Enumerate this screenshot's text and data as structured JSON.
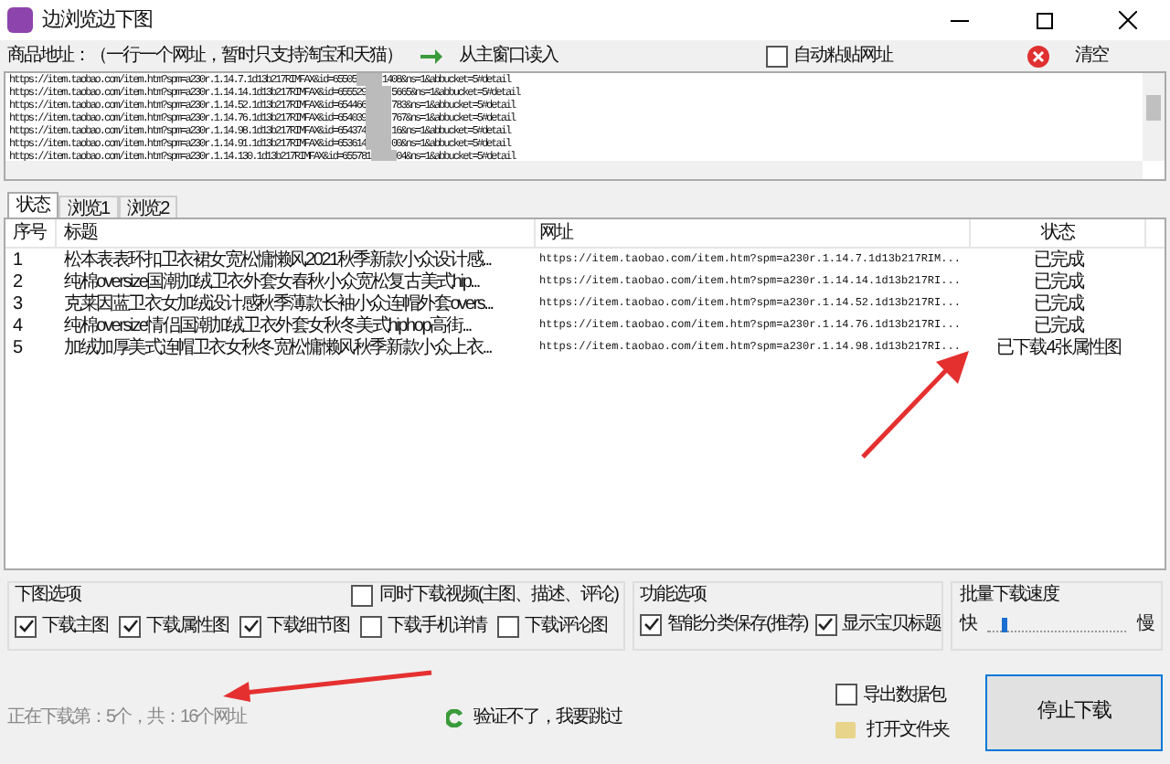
{
  "window": {
    "title": "边浏览边下图"
  },
  "address": {
    "label": "商品地址：（一行一个网址，暂时只支持淘宝和天猫）",
    "read_button": "从主窗口读入",
    "auto_paste": {
      "label": "自动粘贴网址",
      "checked": false
    },
    "clear_button": "清空"
  },
  "urls": [
    {
      "start": "https://item.taobao.com/item.htm?spm=a230r.1.14.7.1d13b217RIMFAX&id=65505",
      "end": "1408&ns=1&abbucket=5#detail"
    },
    {
      "start": "https://item.taobao.com/item.htm?spm=a230r.1.14.14.1d13b217RIMFAX&id=655529",
      "end": "5665&ns=1&abbucket=5#detail"
    },
    {
      "start": "https://item.taobao.com/item.htm?spm=a230r.1.14.52.1d13b217RIMFAX&id=654466",
      "end": "783&ns=1&abbucket=5#detail"
    },
    {
      "start": "https://item.taobao.com/item.htm?spm=a230r.1.14.76.1d13b217RIMFAX&id=654039",
      "end": "767&ns=1&abbucket=5#detail"
    },
    {
      "start": "https://item.taobao.com/item.htm?spm=a230r.1.14.98.1d13b217RIMFAX&id=654374",
      "end": "16&ns=1&abbucket=5#detail"
    },
    {
      "start": "https://item.taobao.com/item.htm?spm=a230r.1.14.91.1d13b217RIMFAX&id=653614",
      "end": "00&ns=1&abbucket=5#detail"
    },
    {
      "start": "https://item.taobao.com/item.htm?spm=a230r.1.14.130.1d13b217RIMFAX&id=655781",
      "end": "04&ns=1&abbucket=5#detail"
    }
  ],
  "tabs": [
    {
      "label": "状态",
      "selected": true
    },
    {
      "label": "浏览1",
      "selected": false
    },
    {
      "label": "浏览2",
      "selected": false
    }
  ],
  "table": {
    "columns": [
      "序号",
      "标题",
      "网址",
      "状态"
    ],
    "rows": [
      [
        "1",
        "松本表表环扣卫衣裙女宽松慵懒风2021秋季新款小众设计感...",
        "https://item.taobao.com/item.htm?spm=a230r.1.14.7.1d13b217RIM...",
        "已完成"
      ],
      [
        "2",
        "纯棉oversize国潮加绒卫衣外套女春秋小众宽松复古美式hip...",
        "https://item.taobao.com/item.htm?spm=a230r.1.14.14.1d13b217RI...",
        "已完成"
      ],
      [
        "3",
        "克莱因蓝卫衣女加绒设计感秋季薄款长袖小众连帽外套overs...",
        "https://item.taobao.com/item.htm?spm=a230r.1.14.52.1d13b217RI...",
        "已完成"
      ],
      [
        "4",
        "纯棉oversize情侣国潮加绒卫衣外套女秋冬美式hiphop高街...",
        "https://item.taobao.com/item.htm?spm=a230r.1.14.76.1d13b217RI...",
        "已完成"
      ],
      [
        "5",
        "加绒加厚美式连帽卫衣女秋冬宽松慵懒风秋季新款小众上衣...",
        "https://item.taobao.com/item.htm?spm=a230r.1.14.98.1d13b217RI...",
        "已下载4张属性图"
      ]
    ]
  },
  "download_options": {
    "title": "下图选项",
    "video": {
      "label": "同时下载视频(主图、描述、评论)",
      "checked": false
    },
    "items": [
      {
        "label": "下载主图",
        "checked": true
      },
      {
        "label": "下载属性图",
        "checked": true
      },
      {
        "label": "下载细节图",
        "checked": true
      },
      {
        "label": "下载手机详情",
        "checked": false
      },
      {
        "label": "下载评论图",
        "checked": false
      }
    ]
  },
  "function_options": {
    "title": "功能选项",
    "items": [
      {
        "label": "智能分类保存(推荐)",
        "checked": true
      },
      {
        "label": "显示宝贝标题",
        "checked": true
      }
    ]
  },
  "speed": {
    "title": "批量下载速度",
    "fast": "快",
    "slow": "慢",
    "level": 0.1
  },
  "status": "正在下载第：5个，共：16个网址",
  "skip_link": "验证不了，我要跳过",
  "export": {
    "label": "导出数据包",
    "checked": false
  },
  "open_folder": "打开文件夹",
  "stop_button": "停止下载"
}
